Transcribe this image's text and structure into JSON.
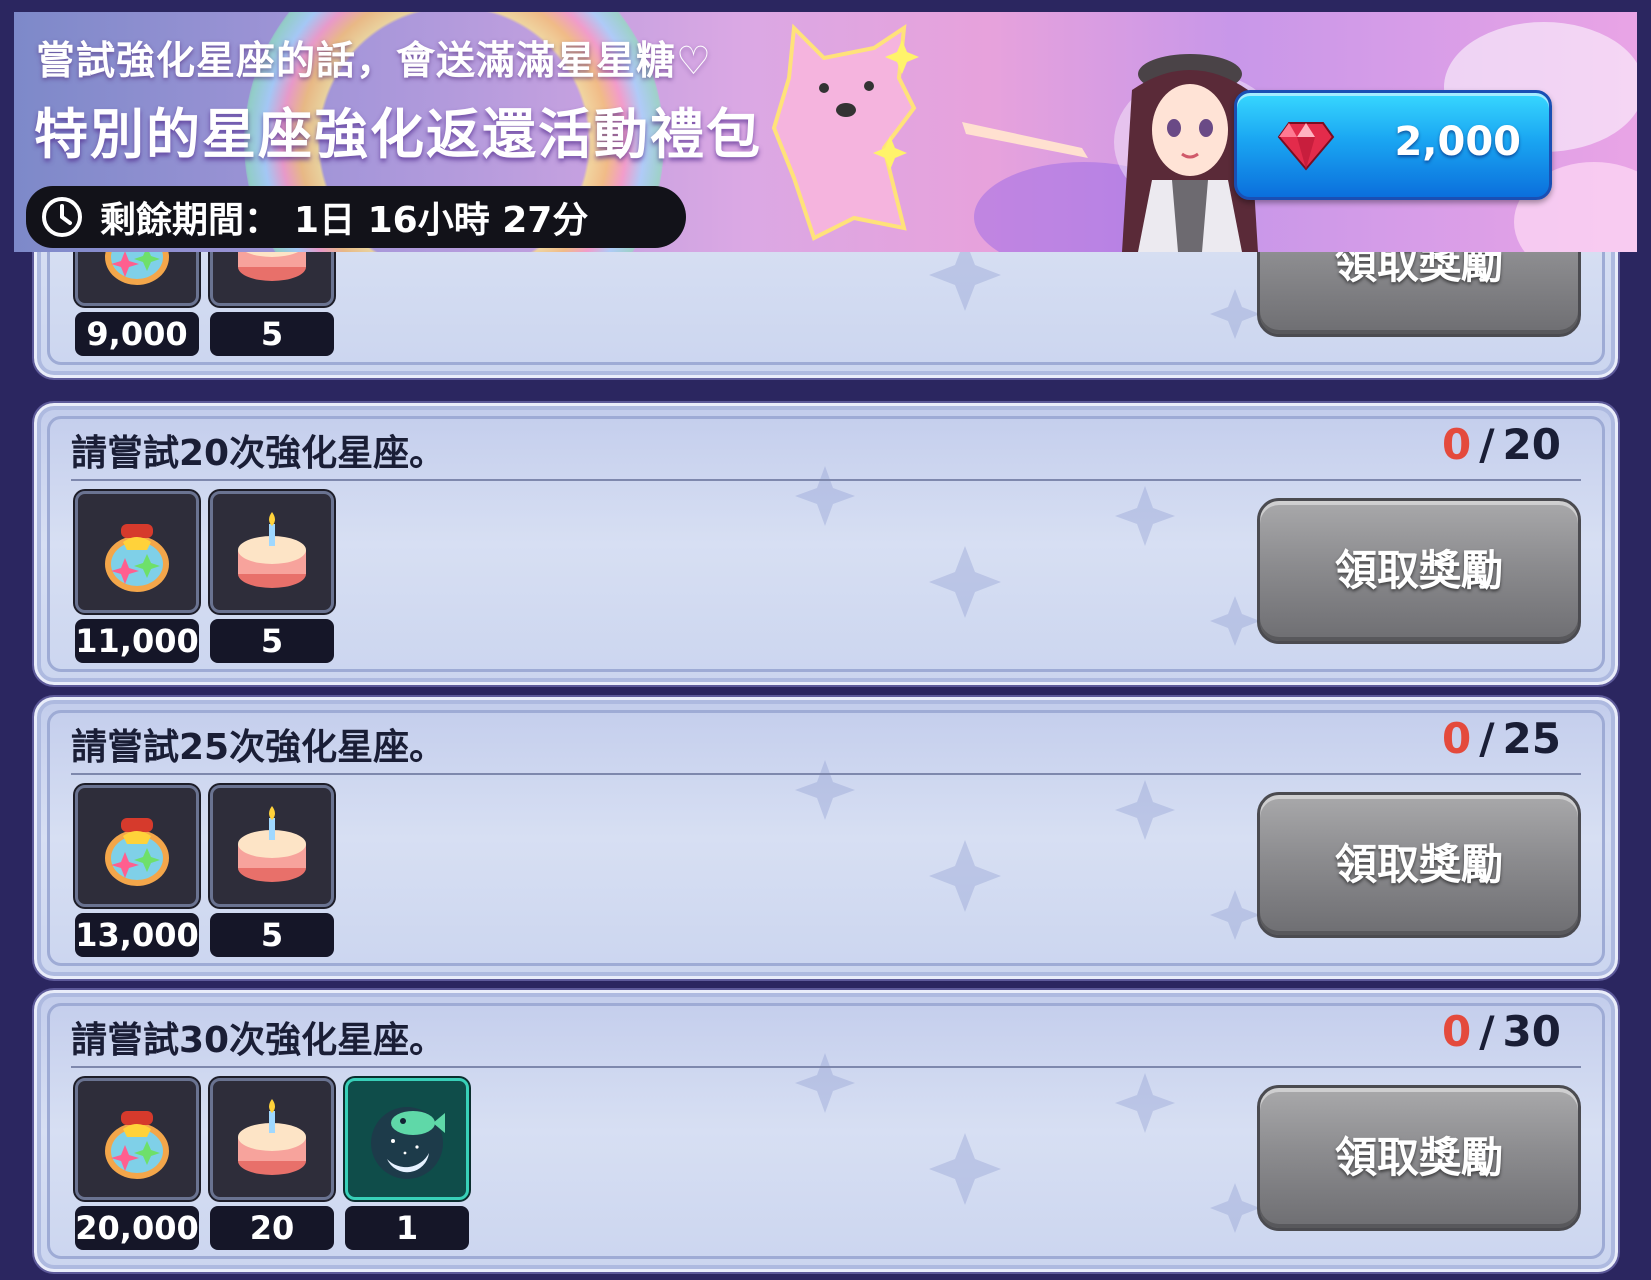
{
  "banner": {
    "line1": "嘗試強化星座的話，會送滿滿星星糖♡",
    "line2": "特別的星座強化返還活動禮包",
    "timer_label": "剩餘期間：",
    "timer_value": "1日 16小時 27分",
    "price": "2,000"
  },
  "missions": [
    {
      "title": "",
      "progress_current": "",
      "progress_total": "",
      "claim_label": "領取獎勵",
      "rewards": [
        {
          "icon": "star-candy-jar-icon",
          "qty": "9,000"
        },
        {
          "icon": "cake-icon",
          "qty": "5"
        }
      ]
    },
    {
      "title": "請嘗試20次強化星座。",
      "progress_current": "0",
      "progress_total": "20",
      "claim_label": "領取獎勵",
      "rewards": [
        {
          "icon": "star-candy-jar-icon",
          "qty": "11,000"
        },
        {
          "icon": "cake-icon",
          "qty": "5"
        }
      ]
    },
    {
      "title": "請嘗試25次強化星座。",
      "progress_current": "0",
      "progress_total": "25",
      "claim_label": "領取獎勵",
      "rewards": [
        {
          "icon": "star-candy-jar-icon",
          "qty": "13,000"
        },
        {
          "icon": "cake-icon",
          "qty": "5"
        }
      ]
    },
    {
      "title": "請嘗試30次強化星座。",
      "progress_current": "0",
      "progress_total": "30",
      "claim_label": "領取獎勵",
      "rewards": [
        {
          "icon": "star-candy-jar-icon",
          "qty": "20,000"
        },
        {
          "icon": "cake-icon",
          "qty": "20"
        },
        {
          "icon": "moon-fish-icon",
          "qty": "1"
        }
      ]
    }
  ],
  "colors": {
    "progress_current": "#e44a3c",
    "price_button": "#1aa6f2",
    "claim_button": "#8c8c8f",
    "background": "#2b2660"
  }
}
